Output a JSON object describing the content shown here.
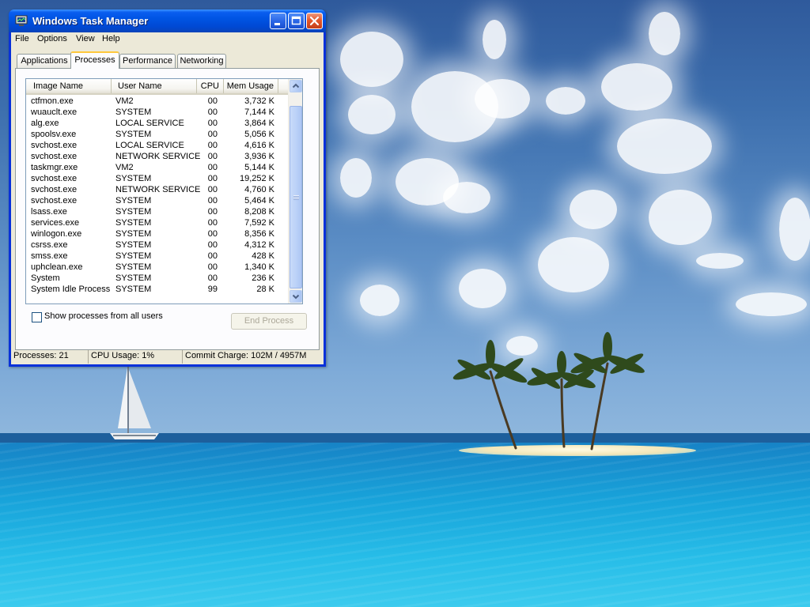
{
  "window": {
    "title": "Windows Task Manager",
    "icon": "task-manager-icon",
    "controls": [
      "minimize-icon",
      "maximize-icon",
      "close-icon"
    ]
  },
  "menu": [
    "File",
    "Options",
    "View",
    "Help"
  ],
  "tabs": [
    {
      "label": "Applications",
      "active": false
    },
    {
      "label": "Processes",
      "active": true
    },
    {
      "label": "Performance",
      "active": false
    },
    {
      "label": "Networking",
      "active": false
    }
  ],
  "columns": {
    "name": "Image Name",
    "user": "User Name",
    "cpu": "CPU",
    "mem": "Mem Usage"
  },
  "processes": [
    {
      "name": "ctfmon.exe",
      "user": "VM2",
      "cpu": "00",
      "mem": "3,732 K"
    },
    {
      "name": "wuauclt.exe",
      "user": "SYSTEM",
      "cpu": "00",
      "mem": "7,144 K"
    },
    {
      "name": "alg.exe",
      "user": "LOCAL SERVICE",
      "cpu": "00",
      "mem": "3,864 K"
    },
    {
      "name": "spoolsv.exe",
      "user": "SYSTEM",
      "cpu": "00",
      "mem": "5,056 K"
    },
    {
      "name": "svchost.exe",
      "user": "LOCAL SERVICE",
      "cpu": "00",
      "mem": "4,616 K"
    },
    {
      "name": "svchost.exe",
      "user": "NETWORK SERVICE",
      "cpu": "00",
      "mem": "3,936 K"
    },
    {
      "name": "taskmgr.exe",
      "user": "VM2",
      "cpu": "00",
      "mem": "5,144 K"
    },
    {
      "name": "svchost.exe",
      "user": "SYSTEM",
      "cpu": "00",
      "mem": "19,252 K"
    },
    {
      "name": "svchost.exe",
      "user": "NETWORK SERVICE",
      "cpu": "00",
      "mem": "4,760 K"
    },
    {
      "name": "svchost.exe",
      "user": "SYSTEM",
      "cpu": "00",
      "mem": "5,464 K"
    },
    {
      "name": "lsass.exe",
      "user": "SYSTEM",
      "cpu": "00",
      "mem": "8,208 K"
    },
    {
      "name": "services.exe",
      "user": "SYSTEM",
      "cpu": "00",
      "mem": "7,592 K"
    },
    {
      "name": "winlogon.exe",
      "user": "SYSTEM",
      "cpu": "00",
      "mem": "8,356 K"
    },
    {
      "name": "csrss.exe",
      "user": "SYSTEM",
      "cpu": "00",
      "mem": "4,312 K"
    },
    {
      "name": "smss.exe",
      "user": "SYSTEM",
      "cpu": "00",
      "mem": "428 K"
    },
    {
      "name": "uphclean.exe",
      "user": "SYSTEM",
      "cpu": "00",
      "mem": "1,340 K"
    },
    {
      "name": "System",
      "user": "SYSTEM",
      "cpu": "00",
      "mem": "236 K"
    },
    {
      "name": "System Idle Process",
      "user": "SYSTEM",
      "cpu": "99",
      "mem": "28 K"
    }
  ],
  "show_all_users": {
    "label": "Show processes from all users",
    "checked": false
  },
  "end_process": {
    "label": "End Process",
    "enabled": false
  },
  "status": {
    "processes": "Processes: 21",
    "cpu": "CPU Usage: 1%",
    "commit": "Commit Charge: 102M / 4957M"
  },
  "colors": {
    "titlebar_blue": "#0054e3",
    "window_frame": "#0831d9",
    "dialog_face": "#ece9d8",
    "active_tab_accent": "#ffc83c",
    "scrollbar_blue": "#bcd2f8"
  },
  "wallpaper": {
    "icons": [
      "palm-tree-icon",
      "sailboat-icon",
      "island-icon"
    ]
  }
}
